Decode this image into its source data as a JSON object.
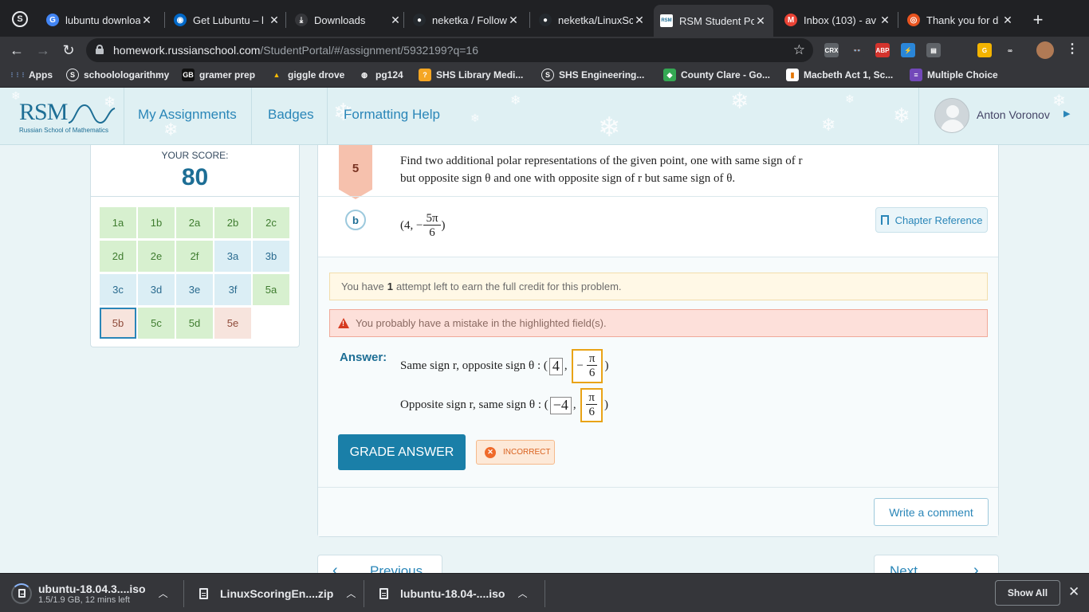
{
  "browser": {
    "tabs": [
      {
        "title": "lubuntu downloa",
        "icon": "google-icon",
        "color": "#4285f4",
        "glyph": "G"
      },
      {
        "title": "Get Lubuntu – l",
        "icon": "lubuntu-icon",
        "color": "#0068c8",
        "glyph": "◉"
      },
      {
        "title": "Downloads",
        "icon": "download-icon",
        "color": "#35363a",
        "glyph": "⤓"
      },
      {
        "title": "neketka / Follow",
        "icon": "github-icon",
        "color": "#24292e",
        "glyph": "●"
      },
      {
        "title": "neketka/LinuxSc",
        "icon": "github-icon",
        "color": "#24292e",
        "glyph": "●"
      },
      {
        "title": "RSM Student Po",
        "icon": "rsm-icon",
        "color": "#ffffff",
        "glyph": "RSM"
      },
      {
        "title": "Inbox (103) - av",
        "icon": "gmail-icon",
        "color": "#ea4335",
        "glyph": "M"
      },
      {
        "title": "Thank you for d",
        "icon": "ubuntu-icon",
        "color": "#e95420",
        "glyph": "◎"
      }
    ],
    "active_tab": 5,
    "url": {
      "host": "homework.russianschool.com",
      "path": "/StudentPortal/#/assignment/5932199?q=16"
    },
    "extensions": [
      {
        "label": "CRX",
        "color": "#5f6368"
      },
      {
        "label": "👓",
        "color": "#35363a"
      },
      {
        "label": "ABP",
        "color": "#d4332d"
      },
      {
        "label": "⚡",
        "color": "#2a86d8"
      },
      {
        "label": "▤",
        "color": "#5f6368"
      },
      {
        "label": "G",
        "color": "#f4b400"
      },
      {
        "label": "∞",
        "color": "#35363a"
      }
    ],
    "bookmarks": [
      {
        "label": "Apps",
        "icon": "apps-icon",
        "color": "#35363a",
        "glyph": "⋮⋮⋮"
      },
      {
        "label": "schoolologarithmy",
        "icon": "schoology-icon",
        "color": "#35363a",
        "glyph": "S"
      },
      {
        "label": "gramer prep",
        "icon": "gbl-icon",
        "color": "#111",
        "glyph": "GB"
      },
      {
        "label": "giggle drove",
        "icon": "drive-icon",
        "color": "#35363a",
        "glyph": "▲"
      },
      {
        "label": "pg124",
        "icon": "globe-icon",
        "color": "#35363a",
        "glyph": "◍"
      },
      {
        "label": "SHS Library Medi...",
        "icon": "library-icon",
        "color": "#f5a623",
        "glyph": "?"
      },
      {
        "label": "SHS Engineering...",
        "icon": "schoology-icon",
        "color": "#35363a",
        "glyph": "S"
      },
      {
        "label": "County Clare - Go...",
        "icon": "maps-icon",
        "color": "#34a853",
        "glyph": "◆"
      },
      {
        "label": "Macbeth Act 1, Sc...",
        "icon": "chart-icon",
        "color": "#ffffff",
        "glyph": "▮"
      },
      {
        "label": "Multiple Choice",
        "icon": "forms-icon",
        "color": "#7248b9",
        "glyph": "≡"
      }
    ]
  },
  "rsm": {
    "logo": {
      "text": "RSM",
      "subtitle": "Russian School of Mathematics"
    },
    "nav": [
      "My Assignments",
      "Badges",
      "Formatting Help"
    ],
    "user": "Anton Voronov"
  },
  "score": {
    "label": "YOUR SCORE:",
    "value": "80",
    "problems": [
      {
        "id": "1a",
        "state": "green"
      },
      {
        "id": "1b",
        "state": "green"
      },
      {
        "id": "2a",
        "state": "green"
      },
      {
        "id": "2b",
        "state": "green"
      },
      {
        "id": "2c",
        "state": "green"
      },
      {
        "id": "2d",
        "state": "green"
      },
      {
        "id": "2e",
        "state": "green"
      },
      {
        "id": "2f",
        "state": "green"
      },
      {
        "id": "3a",
        "state": "blue"
      },
      {
        "id": "3b",
        "state": "blue"
      },
      {
        "id": "3c",
        "state": "blue"
      },
      {
        "id": "3d",
        "state": "blue"
      },
      {
        "id": "3e",
        "state": "blue"
      },
      {
        "id": "3f",
        "state": "blue"
      },
      {
        "id": "5a",
        "state": "green"
      },
      {
        "id": "5b",
        "state": "pink",
        "current": true
      },
      {
        "id": "5c",
        "state": "green"
      },
      {
        "id": "5d",
        "state": "green"
      },
      {
        "id": "5e",
        "state": "pink"
      }
    ]
  },
  "question": {
    "number": "5",
    "text_line1": "Find two additional polar representations of the given point, one with same sign of r",
    "text_line2": "but opposite sign θ and one with opposite sign of r but same sign of θ.",
    "part": "b",
    "point": {
      "open": "(4, −",
      "num": "5π",
      "den": "6",
      "close": ")"
    },
    "chapter_reference": "Chapter Reference",
    "attempts_pre": "You have",
    "attempts_count": "1",
    "attempts_post": "attempt left to earn the full credit for this problem.",
    "error_msg": "You probably have a mistake in the highlighted field(s).",
    "answer_label": "Answer:",
    "row1": {
      "label": "Same sign r, opposite sign θ : (",
      "r": "4",
      "theta_sign": "−",
      "theta_num": "π",
      "theta_den": "6",
      "close": ")"
    },
    "row2": {
      "label": "Opposite sign r, same sign θ : (",
      "r": "−4",
      "theta_num": "π",
      "theta_den": "6",
      "close": ")"
    },
    "grade_button": "GRADE ANSWER",
    "status": "INCORRECT",
    "comment_button": "Write a comment"
  },
  "pager": {
    "prev": "Previous",
    "next": "Next"
  },
  "downloads": {
    "items": [
      {
        "name": "ubuntu-18.04.3....iso",
        "sub": "1.5/1.9 GB, 12 mins left"
      },
      {
        "name": "LinuxScoringEn....zip"
      },
      {
        "name": "lubuntu-18.04-....iso"
      }
    ],
    "show_all": "Show All"
  }
}
